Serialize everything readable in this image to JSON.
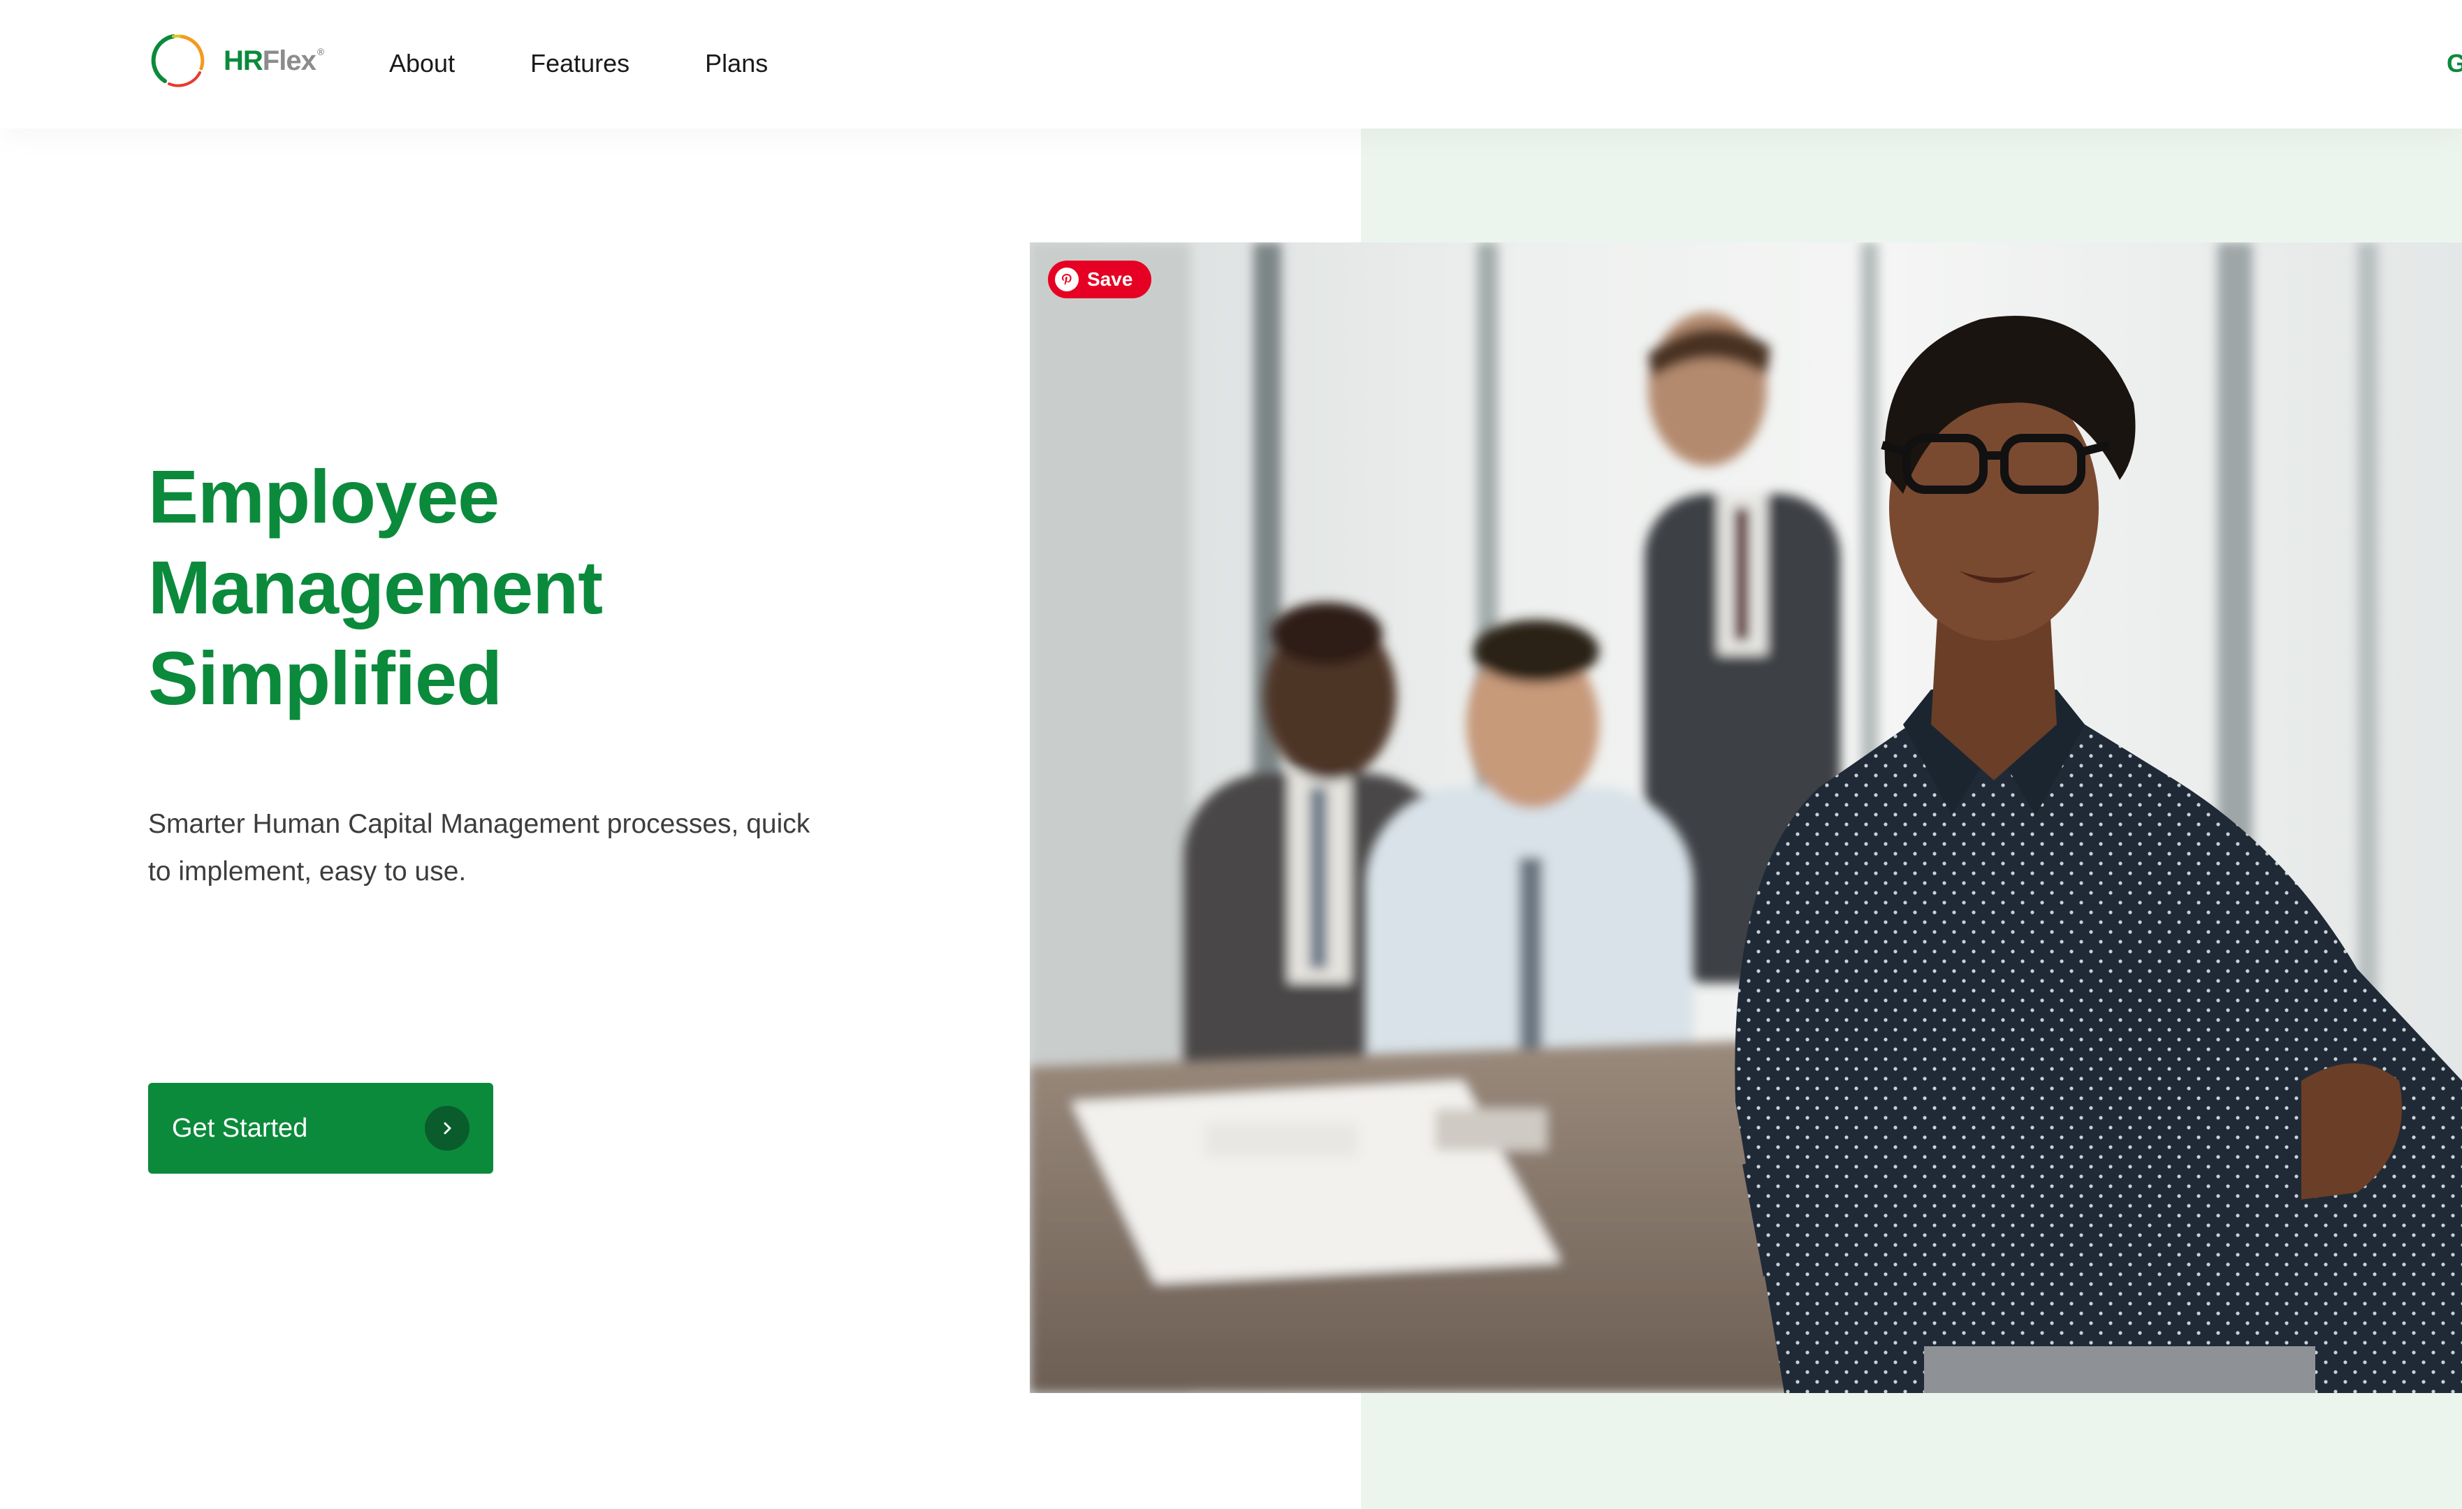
{
  "brand": {
    "name_part1": "HR",
    "name_part2": "Flex",
    "registered": "®",
    "colors": {
      "primary": "#0b8a3c",
      "grey": "#8c8c8c",
      "tint": "#ebf5ee"
    }
  },
  "nav": {
    "items": [
      {
        "label": "About"
      },
      {
        "label": "Features"
      },
      {
        "label": "Plans"
      }
    ],
    "cta_label": "Ge"
  },
  "hero": {
    "title_lines": [
      "Employee",
      "Management",
      "Simplified"
    ],
    "subtitle": "Smarter Human Capital Management processes, quick to implement, easy to use.",
    "cta_label": "Get Started",
    "cta_icon": "chevron-right-icon"
  },
  "pinterest": {
    "label": "Save",
    "color": "#e60023",
    "icon": "pinterest-icon"
  }
}
